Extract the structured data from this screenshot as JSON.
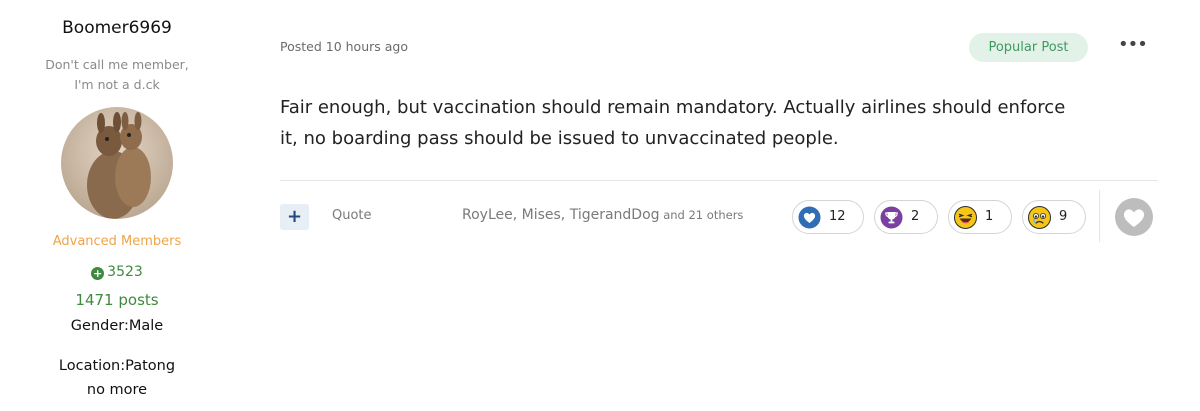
{
  "author": {
    "username": "Boomer6969",
    "tagline_line1": "Don't call me member,",
    "tagline_line2": "I'm not a d.ck",
    "group": "Advanced Members",
    "reputation": "3523",
    "posts": "1471 posts",
    "gender": "Gender:Male",
    "location_line1": "Location:Patong",
    "location_line2": "no more"
  },
  "post": {
    "posted": "Posted 10 hours ago",
    "badge": "Popular Post",
    "more_menu": "•••",
    "content_line1": "Fair enough, but vaccination should remain mandatory. Actually airlines should enforce",
    "content_line2": "it, no boarding pass should be issued to unvaccinated people."
  },
  "actions": {
    "plus_label": "+",
    "quote_label": "Quote",
    "reacted_names": "RoyLee, Mises, TigerandDog",
    "reacted_others": " and 21 others"
  },
  "reactions": [
    {
      "icon": "like-icon",
      "count": "12"
    },
    {
      "icon": "thanks-icon",
      "count": "2"
    },
    {
      "icon": "haha-icon",
      "count": "1"
    },
    {
      "icon": "sad-icon",
      "count": "9"
    }
  ],
  "colors": {
    "accent_green": "#3f8a3f",
    "group_orange": "#f0a44a",
    "badge_bg": "#e3f2e8",
    "badge_text": "#3e9a60",
    "like_blue": "#2f6db5",
    "thanks_purple": "#7b3fa0",
    "emoji_yellow": "#f5c518"
  }
}
